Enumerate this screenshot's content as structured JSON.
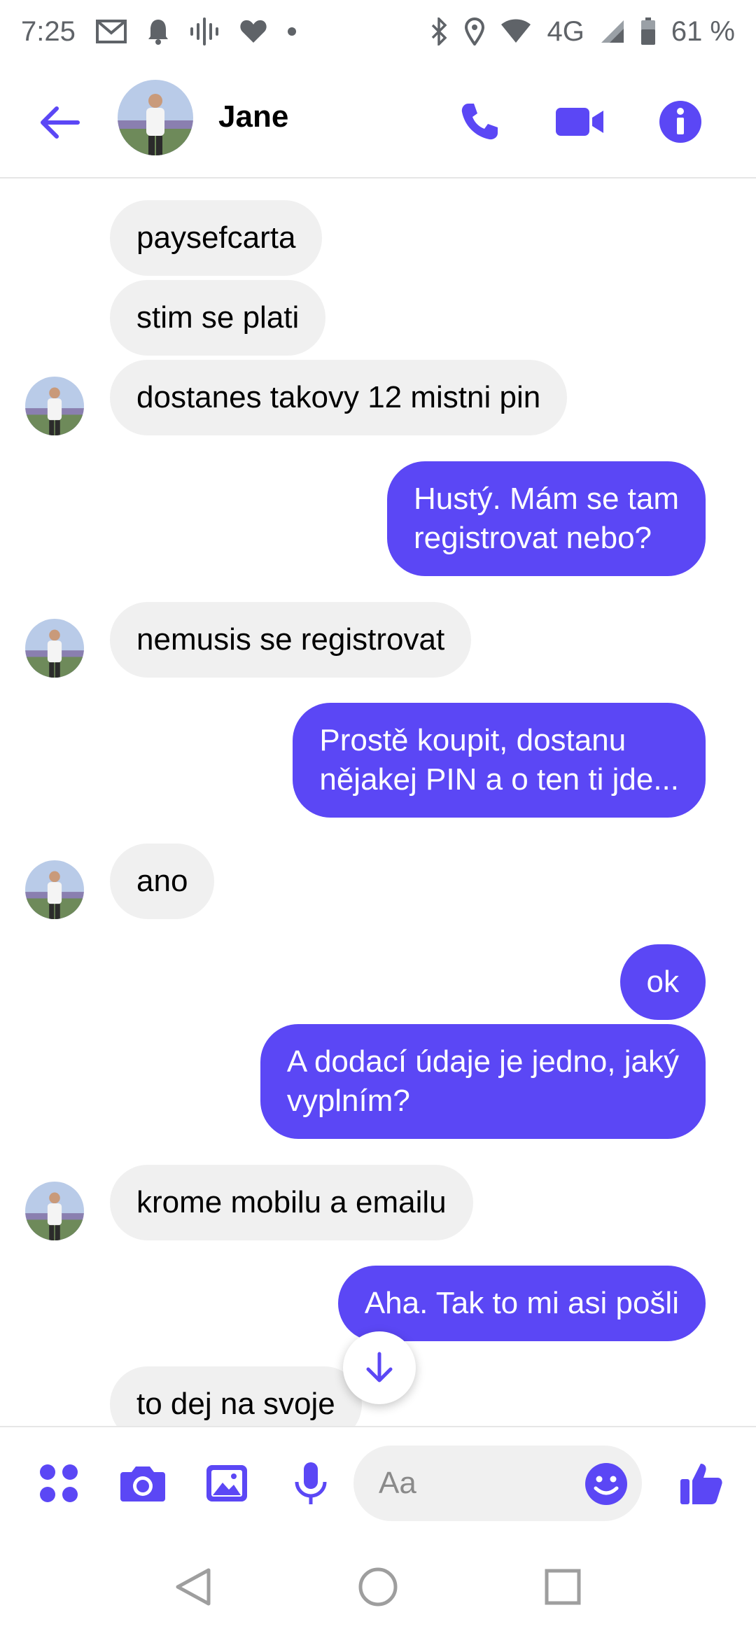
{
  "status_bar": {
    "time": "7:25",
    "network": "4G",
    "battery": "61 %",
    "icons": [
      "gmail-icon",
      "notification-bell-icon",
      "podcast-icon",
      "heart-icon",
      "dot-icon",
      "bluetooth-icon",
      "location-icon",
      "wifi-icon",
      "signal-icon",
      "battery-icon"
    ]
  },
  "header": {
    "contact_name": "Jane",
    "accent_color": "#5b47f5"
  },
  "messages": [
    {
      "from": "contact",
      "text": "paysefcarta"
    },
    {
      "from": "contact",
      "text": "stim se plati"
    },
    {
      "from": "contact",
      "text": "dostanes takovy 12 mistni pin"
    },
    {
      "from": "me",
      "lines": [
        "Hustý. Mám se tam",
        "registrovat nebo?"
      ]
    },
    {
      "from": "contact",
      "text": "nemusis se registrovat"
    },
    {
      "from": "me",
      "lines": [
        "Prostě koupit, dostanu",
        "nějakej PIN a o ten ti jde..."
      ]
    },
    {
      "from": "contact",
      "text": "ano"
    },
    {
      "from": "me",
      "text": "ok"
    },
    {
      "from": "me",
      "lines": [
        "A dodací údaje je jedno, jaký",
        "vyplním?"
      ]
    },
    {
      "from": "contact",
      "text": "krome mobilu a emailu"
    },
    {
      "from": "me",
      "text": "Aha. Tak to mi asi pošli"
    },
    {
      "from": "contact",
      "text": "to dej na svoje"
    }
  ],
  "composer": {
    "placeholder": "Aa"
  }
}
